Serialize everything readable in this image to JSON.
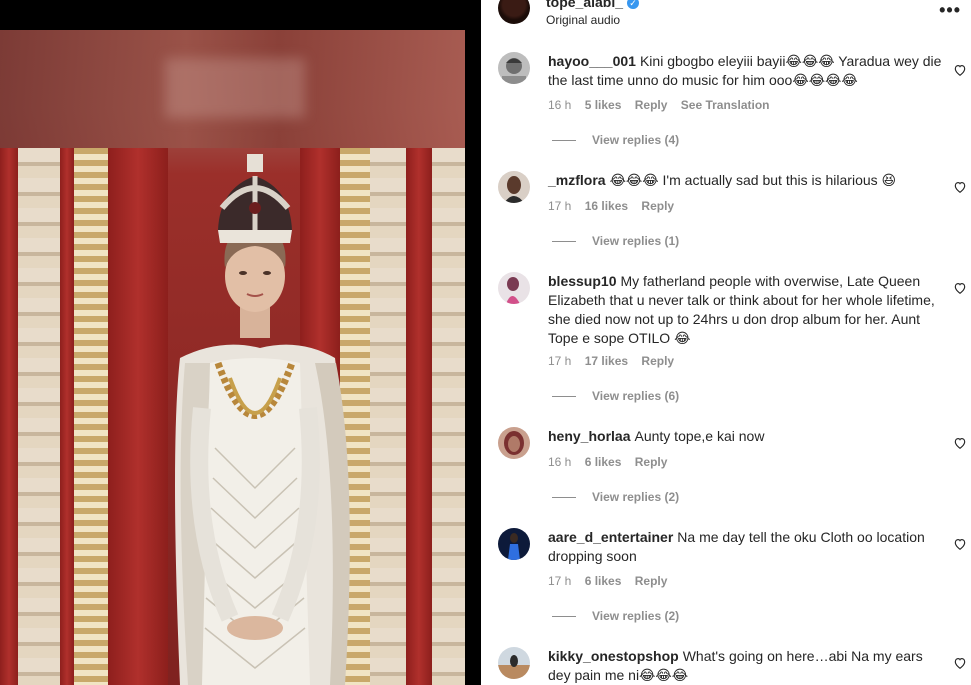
{
  "post": {
    "username": "tope_alabi_",
    "audio": "Original audio",
    "verified_mark": "✓",
    "more_glyph": "•••"
  },
  "comments": [
    {
      "username": "hayoo___001",
      "text": "Kini gbogbo eleyiii bayii😂😂😂 Yaradua wey die the last time unno do music for him ooo😂😂😂😂",
      "time": "16 h",
      "likes": "5 likes",
      "reply": "Reply",
      "translation": "See Translation",
      "view_replies": "View replies (4)",
      "avatar_color": "#9a9a9a"
    },
    {
      "username": "_mzflora",
      "text": "😂😂😂 I'm actually sad but this is hilarious 😆",
      "time": "17 h",
      "likes": "16 likes",
      "reply": "Reply",
      "view_replies": "View replies (1)",
      "avatar_color": "#5a3a2c"
    },
    {
      "username": "blessup10",
      "text": "My fatherland people with overwise, Late Queen Elizabeth that u never talk or think about for her whole lifetime, she died now not up to 24hrs u don drop album for her. Aunt Tope e sope OTILO 😂",
      "time": "17 h",
      "likes": "17 likes",
      "reply": "Reply",
      "view_replies": "View replies (6)",
      "avatar_color": "#c85a8a"
    },
    {
      "username": "heny_horlaa",
      "text": "Aunty tope,e kai now",
      "time": "16 h",
      "likes": "6 likes",
      "reply": "Reply",
      "view_replies": "View replies (2)",
      "avatar_color": "#8a3a3a"
    },
    {
      "username": "aare_d_entertainer",
      "text": "Na me day tell the oku Cloth oo location dropping soon",
      "time": "17 h",
      "likes": "6 likes",
      "reply": "Reply",
      "view_replies": "View replies (2)",
      "avatar_color": "#1f4fa8"
    },
    {
      "username": "kikky_onestopshop",
      "text": "What's going on here…abi Na my ears dey pain me ni😂😂😂",
      "avatar_color": "#b98a60"
    }
  ]
}
